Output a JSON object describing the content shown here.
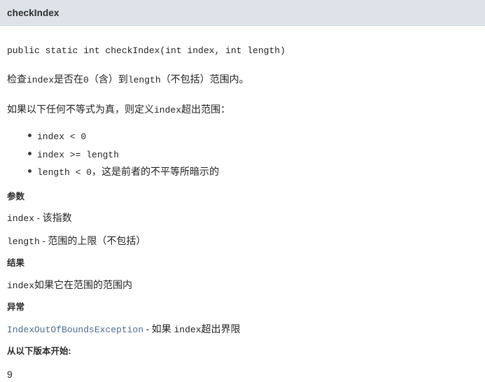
{
  "header": {
    "title": "checkIndex"
  },
  "signature": "public static int checkIndex(int index, int length)",
  "description": {
    "line1_part1": "检查",
    "line1_code1": "index",
    "line1_part2": "是否在",
    "line1_code2": "0",
    "line1_part3": "（含）到",
    "line1_code3": "length",
    "line1_part4": "（不包括）范围内。",
    "line2_part1": "如果以下任何不等式为真，则定义",
    "line2_code1": "index",
    "line2_part2": "超出范围："
  },
  "conditions": [
    {
      "code": "index < 0",
      "zh": ""
    },
    {
      "code": "index >= length",
      "zh": ""
    },
    {
      "code": "length < 0",
      "zh": "，这是前者的不平等所暗示的"
    }
  ],
  "sections": {
    "parameters": {
      "title": "参数",
      "items": [
        {
          "name": "index",
          "dash": " - ",
          "desc": "该指数"
        },
        {
          "name": "length",
          "dash": " - ",
          "desc": "范围的上限（不包括）"
        }
      ]
    },
    "returns": {
      "title": "结果",
      "code": "index",
      "desc": "如果它在范围的范围内"
    },
    "throws": {
      "title": "异常",
      "link": "IndexOutOfBoundsException",
      "dash": " - ",
      "desc_part1": "如果 ",
      "desc_code": "index",
      "desc_part2": "超出界限"
    },
    "since": {
      "title": "从以下版本开始:",
      "value": "9"
    }
  },
  "colors": {
    "header_bg": "#dee3ea",
    "header_border": "#d2d8e0",
    "text": "#222222",
    "link": "#4a6c8f",
    "bullet": "#3b3b3b"
  }
}
